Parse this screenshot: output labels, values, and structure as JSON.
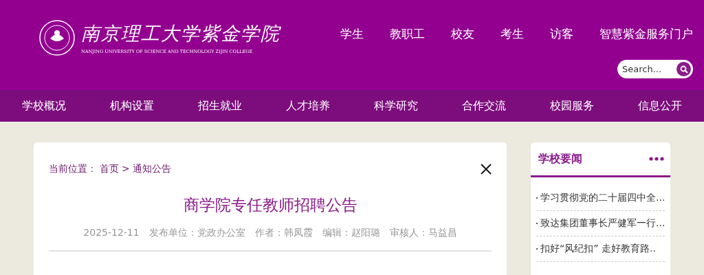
{
  "header": {
    "logo_name": "南京理工大学紫金学院",
    "logo_subtitle": "NANJING UNIVERSITY OF SCIENCE AND TECHNOLOGY ZIJIN COLLEGE",
    "top_links": [
      "学生",
      "教职工",
      "校友",
      "考生",
      "访客",
      "智慧紫金服务门户"
    ],
    "search": {
      "placeholder": "Search..."
    }
  },
  "nav": [
    "学校概况",
    "机构设置",
    "招生就业",
    "人才培养",
    "科学研究",
    "合作交流",
    "校园服务",
    "信息公开"
  ],
  "article": {
    "breadcrumb": {
      "label": "当前位置：",
      "links": [
        "首页",
        "通知公告"
      ],
      "separator": ">"
    },
    "title": "商学院专任教师招聘公告",
    "meta": [
      "2025-12-11",
      "发布单位：党政办公室",
      "作者：韩凤霞",
      "编辑：赵阳璐",
      "审核人：马益昌"
    ]
  },
  "sidebar": {
    "title": "学校要闻",
    "items": [
      "学习贯彻党的二十届四中全...",
      "致达集团董事长严健军一行...",
      "扣好“风纪扣” 走好教育路.."
    ]
  }
}
